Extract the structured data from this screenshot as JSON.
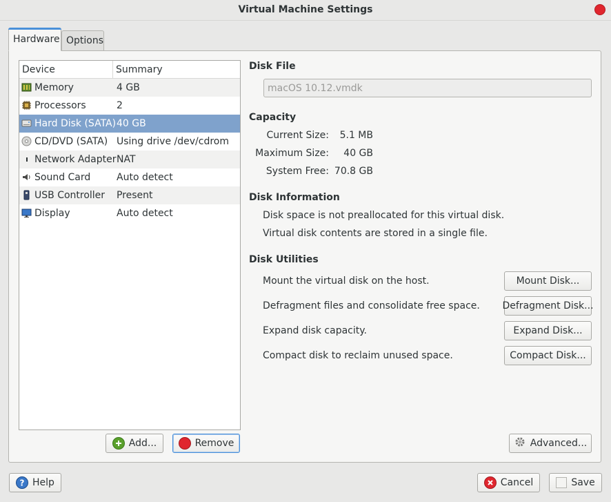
{
  "window": {
    "title": "Virtual Machine Settings"
  },
  "tabs": [
    {
      "label": "Hardware",
      "active": true
    },
    {
      "label": "Options",
      "active": false
    }
  ],
  "device_list": {
    "columns": [
      "Device",
      "Summary"
    ],
    "rows": [
      {
        "device": "Memory",
        "summary": "4 GB",
        "icon": "memory-icon"
      },
      {
        "device": "Processors",
        "summary": "2",
        "icon": "processor-icon"
      },
      {
        "device": "Hard Disk (SATA)",
        "summary": "40 GB",
        "icon": "hard-disk-icon",
        "selected": true
      },
      {
        "device": "CD/DVD (SATA)",
        "summary": "Using drive /dev/cdrom",
        "icon": "cd-dvd-icon"
      },
      {
        "device": "Network Adapter",
        "summary": "NAT",
        "icon": "network-icon"
      },
      {
        "device": "Sound Card",
        "summary": "Auto detect",
        "icon": "sound-icon"
      },
      {
        "device": "USB Controller",
        "summary": "Present",
        "icon": "usb-icon"
      },
      {
        "device": "Display",
        "summary": "Auto detect",
        "icon": "display-icon"
      }
    ],
    "add_label": "Add...",
    "remove_label": "Remove"
  },
  "disk_file": {
    "heading": "Disk File",
    "value": "macOS 10.12.vmdk"
  },
  "capacity": {
    "heading": "Capacity",
    "current_label": "Current Size:",
    "current_value": "5.1 MB",
    "max_label": "Maximum Size:",
    "max_value": "40 GB",
    "free_label": "System Free:",
    "free_value": "70.8 GB"
  },
  "disk_info": {
    "heading": "Disk Information",
    "line1": "Disk space is not preallocated for this virtual disk.",
    "line2": "Virtual disk contents are stored in a single file."
  },
  "disk_utilities": {
    "heading": "Disk Utilities",
    "mount_text": "Mount the virtual disk on the host.",
    "mount_button": "Mount Disk...",
    "defrag_text": "Defragment files and consolidate free space.",
    "defrag_button": "Defragment Disk...",
    "expand_text": "Expand disk capacity.",
    "expand_button": "Expand Disk...",
    "compact_text": "Compact disk to reclaim unused space.",
    "compact_button": "Compact Disk..."
  },
  "advanced_button": "Advanced...",
  "footer": {
    "help_label": "Help",
    "cancel_label": "Cancel",
    "save_label": "Save"
  },
  "colors": {
    "selection": "#7fa2cc",
    "accent": "#4a90d9",
    "close": "#e0262e"
  }
}
